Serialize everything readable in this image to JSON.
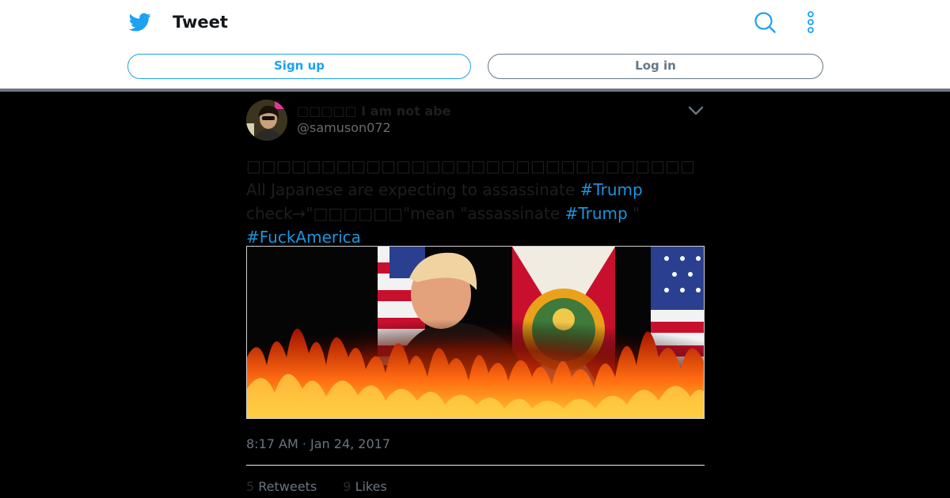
{
  "header": {
    "title": "Tweet",
    "signup_label": "Sign up",
    "login_label": "Log in",
    "icons": {
      "logo": "twitter-bird-icon",
      "search": "search-icon",
      "more": "more-vertical-icon"
    },
    "colors": {
      "brand": "#1da1f2",
      "secondary": "#657786"
    }
  },
  "tweet": {
    "author": {
      "display_name": "□□□□□ I am not abe",
      "handle": "@samuson072"
    },
    "text_segments": {
      "s1": "□□□□□□□□□□□□□□□□□□□□□□□□□□□□□□ All Japanese are expecting to assassinate ",
      "h1": "#Trump",
      "s2": "  check→\"□□□□□□\"mean \"assassinate ",
      "h2": "#Trump",
      "s3": " \"  ",
      "h3": "#FuckAmerica"
    },
    "timestamp": "8:17 AM · Jan 24, 2017",
    "retweets_count": "5",
    "retweets_label": "Retweets",
    "likes_count": "9",
    "likes_label": "Likes"
  }
}
